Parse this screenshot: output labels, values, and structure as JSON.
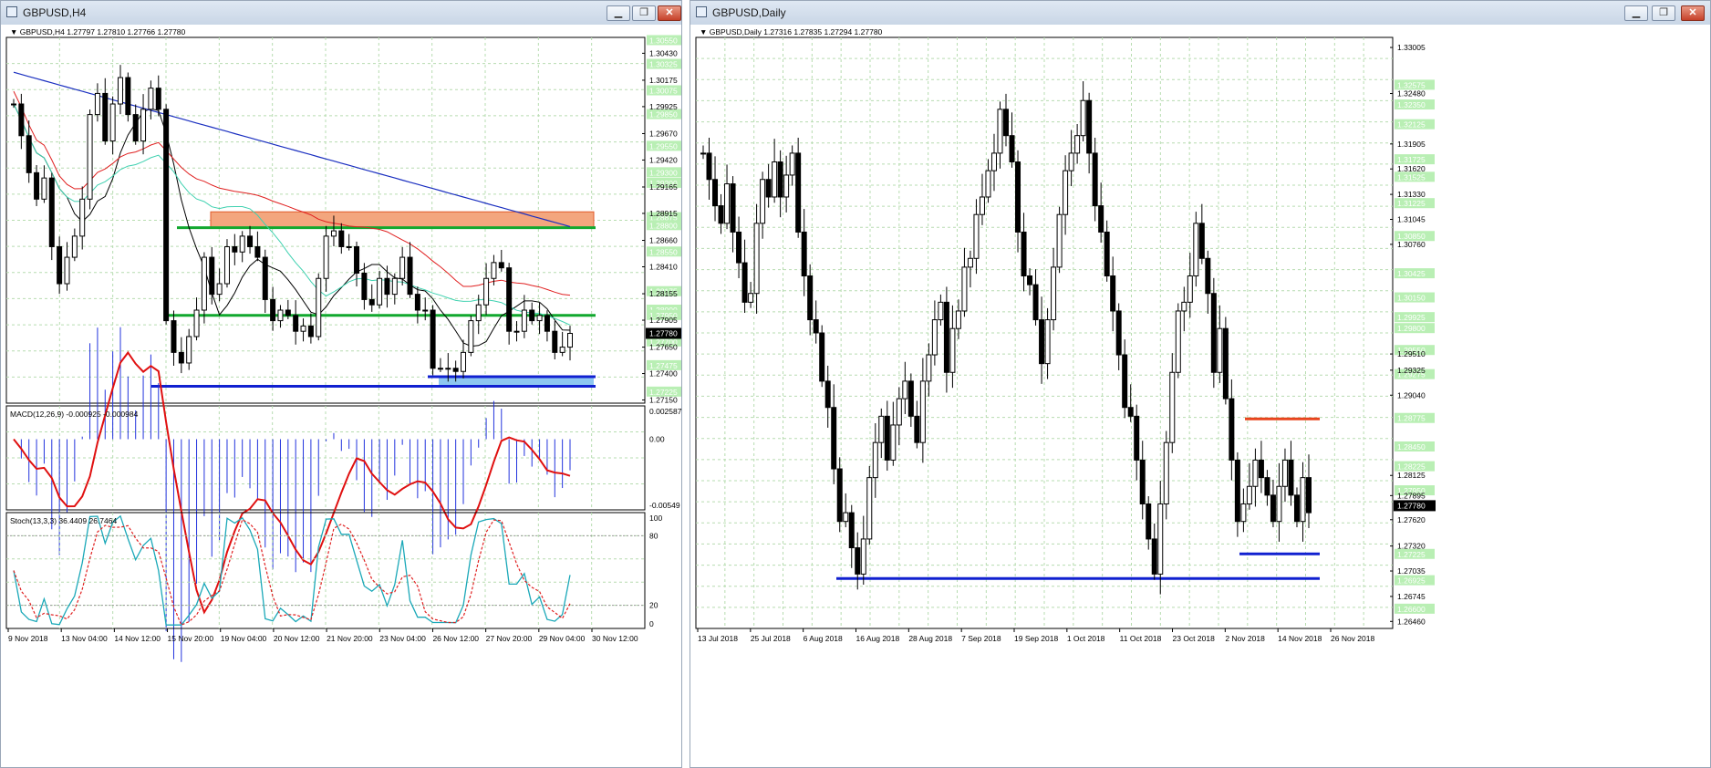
{
  "left_window": {
    "title": "GBPUSD,H4",
    "buttons": {
      "minimize": "▁",
      "maximize": "❐",
      "close": "✕"
    }
  },
  "right_window": {
    "title": "GBPUSD,Daily",
    "buttons": {
      "minimize": "▁",
      "maximize": "❐",
      "close": "✕"
    }
  },
  "chart_data": [
    {
      "type": "candlestick",
      "symbol_label": "GBPUSD,H4",
      "quote_text": "1.27797 1.27810 1.27766 1.27780",
      "ylim": [
        1.2712,
        1.3058
      ],
      "price_ticks": [
        "1.30430",
        "1.30175",
        "1.29925",
        "1.29670",
        "1.29420",
        "1.29165",
        "1.28915",
        "1.28660",
        "1.28410",
        "1.28155",
        "1.27905",
        "1.27650",
        "1.27400",
        "1.27150"
      ],
      "level_marks": [
        "1.30550",
        "1.30325",
        "1.30075",
        "1.29850",
        "1.29550",
        "1.29300",
        "1.29200",
        "1.28875",
        "1.28800",
        "1.28550",
        "1.28175",
        "1.28000",
        "1.27950",
        "1.27700",
        "1.27475",
        "1.27225"
      ],
      "last_price": "1.27780",
      "x_labels": [
        "9 Nov 2018",
        "13 Nov 04:00",
        "14 Nov 12:00",
        "15 Nov 20:00",
        "19 Nov 04:00",
        "20 Nov 12:00",
        "21 Nov 20:00",
        "23 Nov 04:00",
        "26 Nov 12:00",
        "27 Nov 20:00",
        "29 Nov 04:00",
        "30 Nov 12:00"
      ],
      "resistance_zone": [
        1.2878,
        1.2893
      ],
      "green_lines": [
        1.2878,
        1.2795
      ],
      "blue_lines": [
        1.2737,
        1.2728
      ],
      "support_zone": [
        1.2728,
        1.2737
      ],
      "close_path": [
        1.2995,
        1.2965,
        1.293,
        1.2905,
        1.2925,
        1.286,
        1.2825,
        1.285,
        1.287,
        1.2905,
        1.2985,
        1.3005,
        1.296,
        1.2995,
        1.302,
        1.2985,
        1.296,
        1.299,
        1.301,
        1.299,
        1.279,
        1.276,
        1.275,
        1.2775,
        1.28,
        1.285,
        1.2815,
        1.2825,
        1.286,
        1.2855,
        1.287,
        1.286,
        1.285,
        1.281,
        1.279,
        1.28,
        1.2795,
        1.278,
        1.2785,
        1.2775,
        1.283,
        1.287,
        1.2875,
        1.286,
        1.286,
        1.2835,
        1.281,
        1.2805,
        1.283,
        1.2815,
        1.283,
        1.285,
        1.2815,
        1.28,
        1.28,
        1.2745,
        1.2745,
        1.2745,
        1.2742,
        1.276,
        1.279,
        1.2805,
        1.283,
        1.2845,
        1.284,
        1.278,
        1.278,
        1.28,
        1.279,
        1.2795,
        1.278,
        1.276,
        1.2765,
        1.2778
      ]
    },
    {
      "type": "line",
      "name": "MACD(12,26,9) -0.000925 -0.000984",
      "axis_labels": [
        "0.002587",
        "0.00",
        "-0.00549"
      ],
      "ylim": [
        -0.00549,
        0.002587
      ]
    },
    {
      "type": "line",
      "name": "Stoch(13,3,3) 36.4409 26.7464",
      "axis_labels": [
        "100",
        "80",
        "20",
        "0"
      ],
      "ylim": [
        0,
        100
      ],
      "levels": [
        80,
        20
      ]
    },
    {
      "type": "candlestick",
      "symbol_label": "GBPUSD,Daily",
      "quote_text": "1.27316 1.27835 1.27294 1.27780",
      "ylim": [
        1.2638,
        1.3312
      ],
      "price_ticks": [
        "1.33005",
        "1.32480",
        "1.31905",
        "1.31620",
        "1.31330",
        "1.31045",
        "1.30760",
        "1.29510",
        "1.29325",
        "1.29040",
        "1.28125",
        "1.27895",
        "1.27620",
        "1.27320",
        "1.27035",
        "1.26745",
        "1.26460"
      ],
      "level_marks": [
        "1.32575",
        "1.32350",
        "1.32125",
        "1.31725",
        "1.31525",
        "1.31225",
        "1.30850",
        "1.30425",
        "1.30150",
        "1.29925",
        "1.29800",
        "1.29550",
        "1.29275",
        "1.28775",
        "1.28450",
        "1.28225",
        "1.27950",
        "1.27225",
        "1.26925",
        "1.26600"
      ],
      "last_price": "1.27780",
      "x_labels": [
        "13 Jul 2018",
        "25 Jul 2018",
        "6 Aug 2018",
        "16 Aug 2018",
        "28 Aug 2018",
        "7 Sep 2018",
        "19 Sep 2018",
        "1 Oct 2018",
        "11 Oct 2018",
        "23 Oct 2018",
        "2 Nov 2018",
        "14 Nov 2018",
        "26 Nov 2018"
      ],
      "red_line": 1.2877,
      "blue_lines": [
        1.2723,
        1.2695
      ],
      "close_path": [
        1.318,
        1.315,
        1.312,
        1.31,
        1.3145,
        1.309,
        1.3055,
        1.301,
        1.302,
        1.31,
        1.315,
        1.313,
        1.317,
        1.313,
        1.3155,
        1.318,
        1.309,
        1.304,
        1.299,
        1.2975,
        1.292,
        1.289,
        1.282,
        1.276,
        1.277,
        1.273,
        1.27,
        1.274,
        1.281,
        1.285,
        1.288,
        1.283,
        1.287,
        1.29,
        1.292,
        1.288,
        1.285,
        1.292,
        1.295,
        1.299,
        1.301,
        1.293,
        1.298,
        1.3,
        1.305,
        1.306,
        1.311,
        1.313,
        1.316,
        1.318,
        1.323,
        1.32,
        1.317,
        1.309,
        1.304,
        1.303,
        1.299,
        1.294,
        1.299,
        1.305,
        1.311,
        1.316,
        1.318,
        1.32,
        1.324,
        1.318,
        1.312,
        1.309,
        1.304,
        1.3,
        1.295,
        1.289,
        1.288,
        1.283,
        1.278,
        1.274,
        1.27,
        1.278,
        1.285,
        1.293,
        1.3,
        1.301,
        1.304,
        1.31,
        1.306,
        1.302,
        1.293,
        1.298,
        1.29,
        1.283,
        1.276,
        1.278,
        1.28,
        1.283,
        1.281,
        1.279,
        1.276,
        1.28,
        1.283,
        1.279,
        1.276,
        1.281,
        1.277
      ]
    }
  ]
}
